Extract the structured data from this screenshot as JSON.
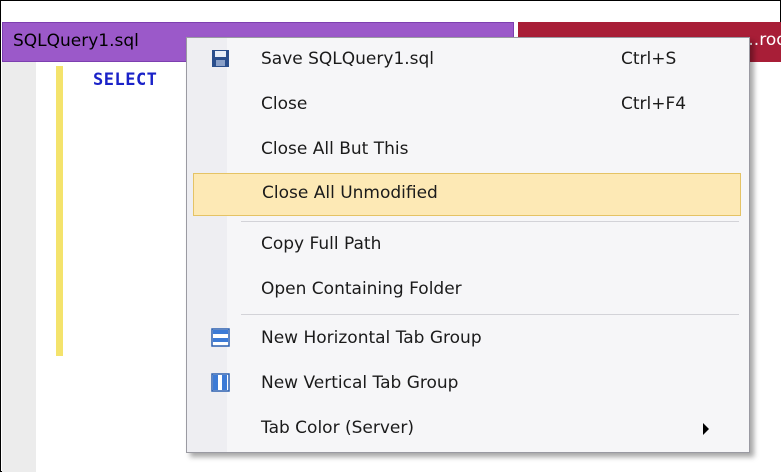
{
  "tabs": {
    "active_label": "SQLQuery1.sql",
    "inactive_label": "...roo"
  },
  "editor": {
    "code_text": "SELECT"
  },
  "context_menu": {
    "items": [
      {
        "label": "Save SQLQuery1.sql",
        "shortcut": "Ctrl+S",
        "icon": "save-icon"
      },
      {
        "label": "Close",
        "shortcut": "Ctrl+F4"
      },
      {
        "label": "Close All But This"
      },
      {
        "label": "Close All Unmodified",
        "highlighted": true
      },
      {
        "label": "Copy Full Path"
      },
      {
        "label": "Open Containing Folder"
      },
      {
        "label": "New Horizontal Tab Group",
        "icon": "horizontal-tab-group-icon"
      },
      {
        "label": "New Vertical Tab Group",
        "icon": "vertical-tab-group-icon"
      },
      {
        "label": "Tab Color (Server)",
        "submenu": true
      }
    ]
  },
  "colors": {
    "active_tab": "#9b59c9",
    "inactive_tab": "#a81e37",
    "highlight": "#fde9b5",
    "keyword": "#1a22c8"
  }
}
